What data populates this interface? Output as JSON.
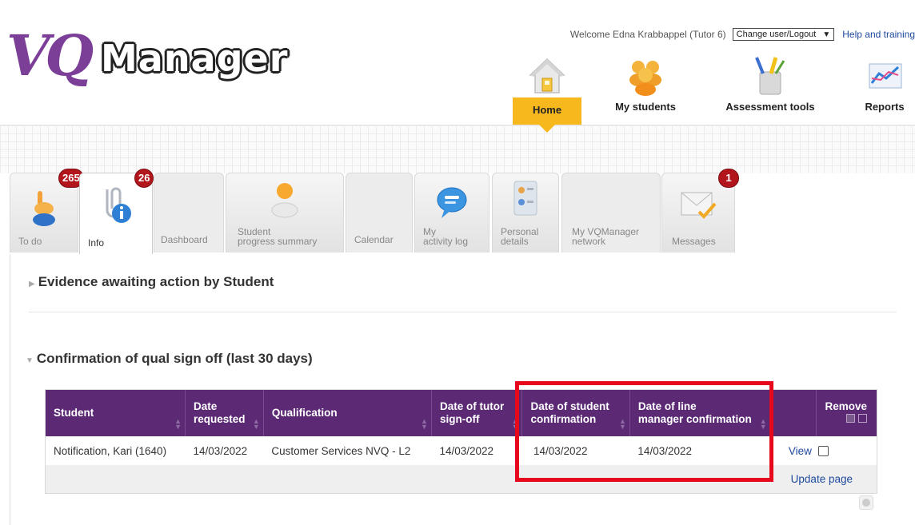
{
  "header": {
    "logo_vq": "VQ",
    "logo_manager": "Manager",
    "welcome": "Welcome Edna Krabbappel (Tutor 6)",
    "user_select": "Change user/Logout",
    "help_link": "Help and training"
  },
  "nav": [
    {
      "label": "Home",
      "icon": "home-icon",
      "active": true
    },
    {
      "label": "My students",
      "icon": "students-icon"
    },
    {
      "label": "Assessment tools",
      "icon": "tools-icon"
    },
    {
      "label": "Reports",
      "icon": "reports-icon"
    }
  ],
  "tabs": [
    {
      "label": "To do",
      "badge": "265"
    },
    {
      "label": "Info",
      "badge": "26",
      "active": true
    },
    {
      "label": "Dashboard"
    },
    {
      "label_line1": "Student",
      "label_line2": "progress summary"
    },
    {
      "label": "Calendar"
    },
    {
      "label_line1": "My",
      "label_line2": "activity log"
    },
    {
      "label_line1": "Personal",
      "label_line2": "details"
    },
    {
      "label_line1": "My VQManager",
      "label_line2": "network"
    },
    {
      "label": "Messages",
      "badge": "1"
    }
  ],
  "sections": {
    "evidence_title": "Evidence awaiting action by Student",
    "confirmation_title": "Confirmation of qual sign off (last 30 days)"
  },
  "table": {
    "headers": {
      "student": "Student",
      "date_requested_1": "Date",
      "date_requested_2": "requested",
      "qualification": "Qualification",
      "tutor_signoff_1": "Date of tutor",
      "tutor_signoff_2": "sign-off",
      "student_conf_1": "Date of student",
      "student_conf_2": "confirmation",
      "line_mgr_1": "Date of line",
      "line_mgr_2": "manager confirmation",
      "remove": "Remove"
    },
    "rows": [
      {
        "student": "Notification, Kari (1640)",
        "date_requested": "14/03/2022",
        "qualification": "Customer Services NVQ - L2",
        "tutor_signoff": "14/03/2022",
        "student_confirmation": "14/03/2022",
        "line_manager_confirmation": "14/03/2022",
        "view": "View"
      }
    ],
    "update_page": "Update page"
  },
  "colors": {
    "brand_purple": "#5c2a75",
    "home_yellow": "#f7b81e",
    "badge_red": "#b3151d",
    "highlight_red": "#e8081c"
  }
}
